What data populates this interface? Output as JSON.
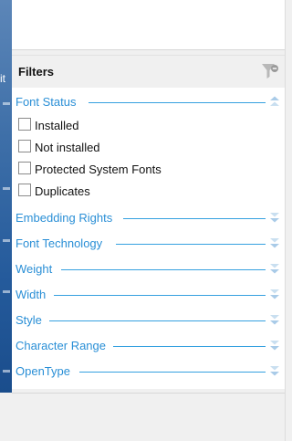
{
  "filters": {
    "title": "Filters",
    "clear_icon": "filter-clear-icon",
    "sections": [
      {
        "label": "Font Status",
        "expanded": true,
        "options": [
          {
            "label": "Installed",
            "checked": false
          },
          {
            "label": "Not installed",
            "checked": false
          },
          {
            "label": "Protected System Fonts",
            "checked": false
          },
          {
            "label": "Duplicates",
            "checked": false
          }
        ]
      },
      {
        "label": "Embedding Rights",
        "expanded": false
      },
      {
        "label": "Font Technology",
        "expanded": false
      },
      {
        "label": "Weight",
        "expanded": false
      },
      {
        "label": "Width",
        "expanded": false
      },
      {
        "label": "Style",
        "expanded": false
      },
      {
        "label": "Character Range",
        "expanded": false
      },
      {
        "label": "OpenType",
        "expanded": false
      }
    ]
  },
  "desktop": {
    "fragment": "it"
  },
  "colors": {
    "accent": "#2a8fd6",
    "line": "#36a1e0",
    "chevron": "#a9cbe8",
    "panel_bg": "#f0f0f0",
    "body_bg": "#ffffff"
  }
}
